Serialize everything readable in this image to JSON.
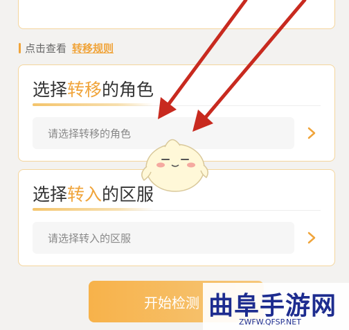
{
  "rules": {
    "prefix": "点击查看",
    "link": "转移规则"
  },
  "role_card": {
    "title_pre": "选择",
    "title_hl": "转移",
    "title_post": "的角色",
    "placeholder": "请选择转移的角色"
  },
  "server_card": {
    "title_pre": "选择",
    "title_hl": "转入",
    "title_post": "的区服",
    "placeholder": "请选择转入的区服"
  },
  "start_button": "开始检测",
  "watermark": {
    "title": "曲阜手游网",
    "url": "ZWFW.QFSP.NET"
  },
  "colors": {
    "accent": "#f0a43a",
    "card_border": "#f4d59c",
    "arrow": "#c82a1f",
    "watermark": "#1d2c8f"
  },
  "icons": [
    "chevron-right-icon",
    "mascot-icon",
    "arrow-annotation"
  ]
}
